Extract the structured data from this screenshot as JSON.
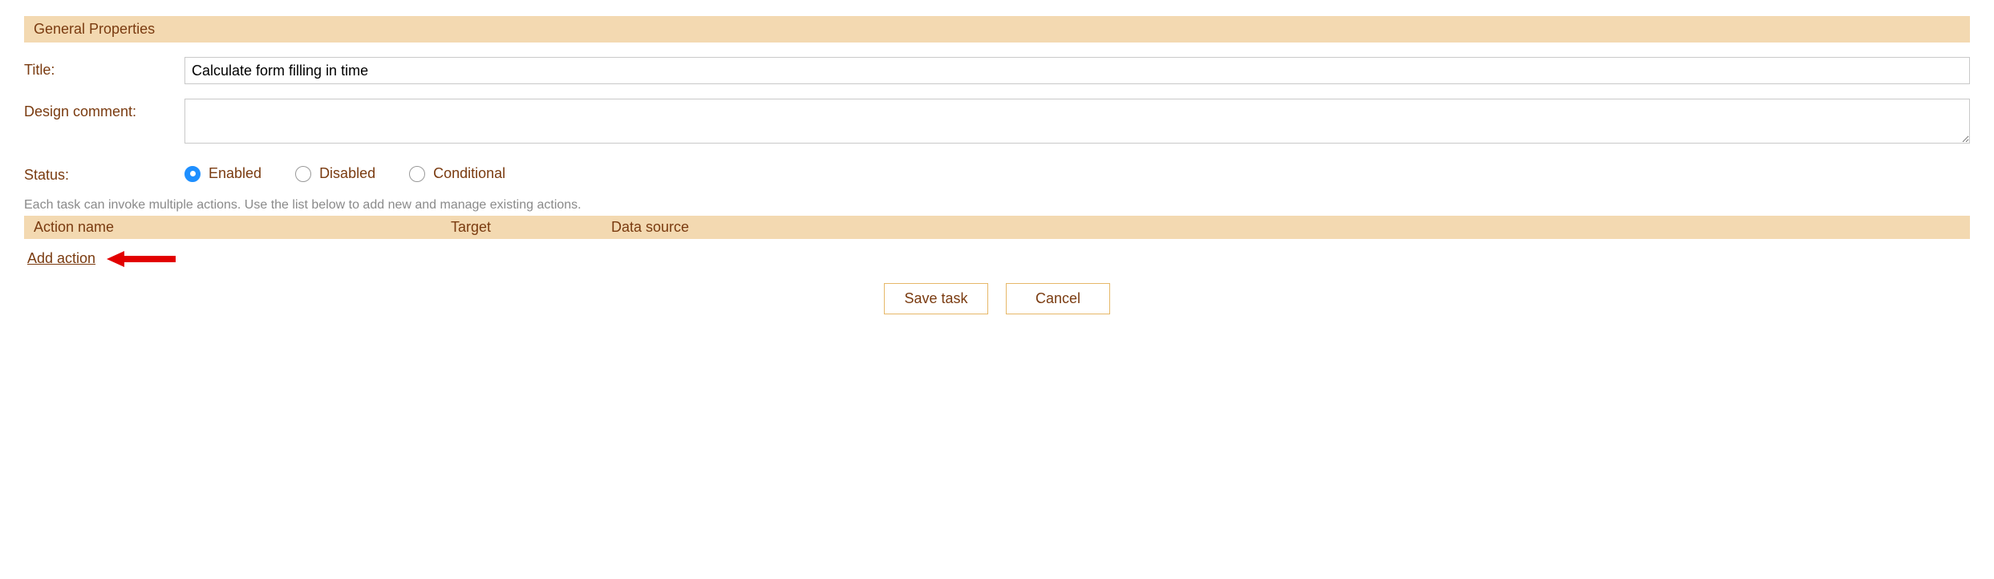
{
  "section_title": "General Properties",
  "form": {
    "title_label": "Title:",
    "title_value": "Calculate form filling in time",
    "design_comment_label": "Design comment:",
    "design_comment_value": "",
    "status_label": "Status:",
    "status_options": {
      "enabled": "Enabled",
      "disabled": "Disabled",
      "conditional": "Conditional"
    },
    "status_selected": "enabled"
  },
  "help_text": "Each task can invoke multiple actions. Use the list below to add new and manage existing actions.",
  "actions_table": {
    "columns": {
      "action_name": "Action name",
      "target": "Target",
      "data_source": "Data source"
    },
    "rows": []
  },
  "add_action_label": "Add action",
  "buttons": {
    "save": "Save task",
    "cancel": "Cancel"
  }
}
